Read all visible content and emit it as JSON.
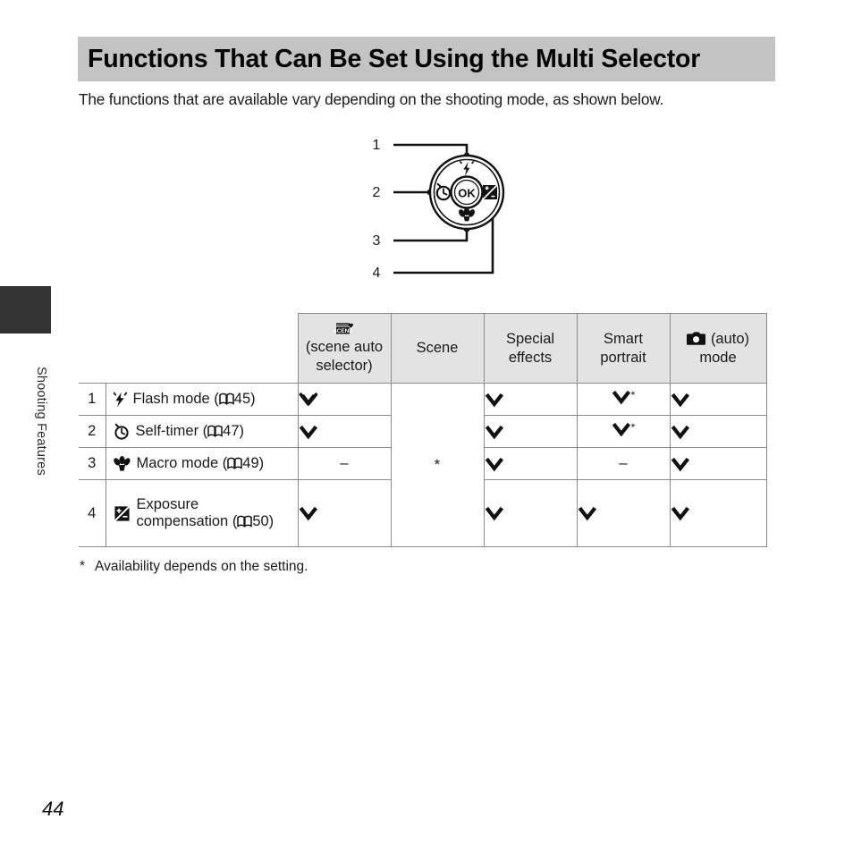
{
  "sidebar": {
    "tab_icon": "dark-tab-marker",
    "section_label": "Shooting Features"
  },
  "header": {
    "title": "Functions That Can Be Set Using the Multi Selector"
  },
  "intro": {
    "text": "The functions that are available vary depending on the shooting mode, as shown below."
  },
  "diagram": {
    "name": "multi-selector-dial",
    "center_button_label": "OK",
    "callouts": [
      {
        "number": "1",
        "target": "flash-button-top"
      },
      {
        "number": "2",
        "target": "self-timer-button-left"
      },
      {
        "number": "3",
        "target": "macro-button-bottom"
      },
      {
        "number": "4",
        "target": "exposure-compensation-button-right"
      }
    ]
  },
  "table": {
    "corner_blank": "",
    "columns": [
      {
        "key": "scene_auto",
        "icon": "scene-auto-selector-icon",
        "icon_text": "SCENE",
        "label": "(scene auto selector)"
      },
      {
        "key": "scene",
        "icon": null,
        "label": "Scene"
      },
      {
        "key": "special_effects",
        "icon": null,
        "label": "Special effects"
      },
      {
        "key": "smart_portrait",
        "icon": null,
        "label": "Smart portrait"
      },
      {
        "key": "auto_mode",
        "icon": "camera-icon",
        "label": "(auto) mode"
      }
    ],
    "scene_merged_value": "*",
    "rows": [
      {
        "num": "1",
        "icon": "flash-icon",
        "label": "Flash mode (",
        "ref_page": "45",
        "label_end": ")",
        "values": {
          "scene_auto": "check",
          "special_effects": "check",
          "smart_portrait": "check-star",
          "auto_mode": "check"
        }
      },
      {
        "num": "2",
        "icon": "self-timer-icon",
        "label": "Self-timer (",
        "ref_page": "47",
        "label_end": ")",
        "values": {
          "scene_auto": "check",
          "special_effects": "check",
          "smart_portrait": "check-star",
          "auto_mode": "check"
        }
      },
      {
        "num": "3",
        "icon": "macro-icon",
        "label": "Macro mode (",
        "ref_page": "49",
        "label_end": ")",
        "values": {
          "scene_auto": "dash",
          "special_effects": "check",
          "smart_portrait": "dash",
          "auto_mode": "check"
        }
      },
      {
        "num": "4",
        "icon": "exposure-compensation-icon",
        "label": "Exposure compensation (",
        "ref_page": "50",
        "label_end": ")",
        "values": {
          "scene_auto": "check",
          "special_effects": "check",
          "smart_portrait": "check",
          "auto_mode": "check"
        }
      }
    ]
  },
  "footnote": {
    "marker": "*",
    "text": "Availability depends on the setting."
  },
  "page_number": "44",
  "colors": {
    "title_bar": "#c3c3c3",
    "table_header": "#e3e3e3",
    "border": "#8a8a8a",
    "side_tab": "#333333"
  }
}
